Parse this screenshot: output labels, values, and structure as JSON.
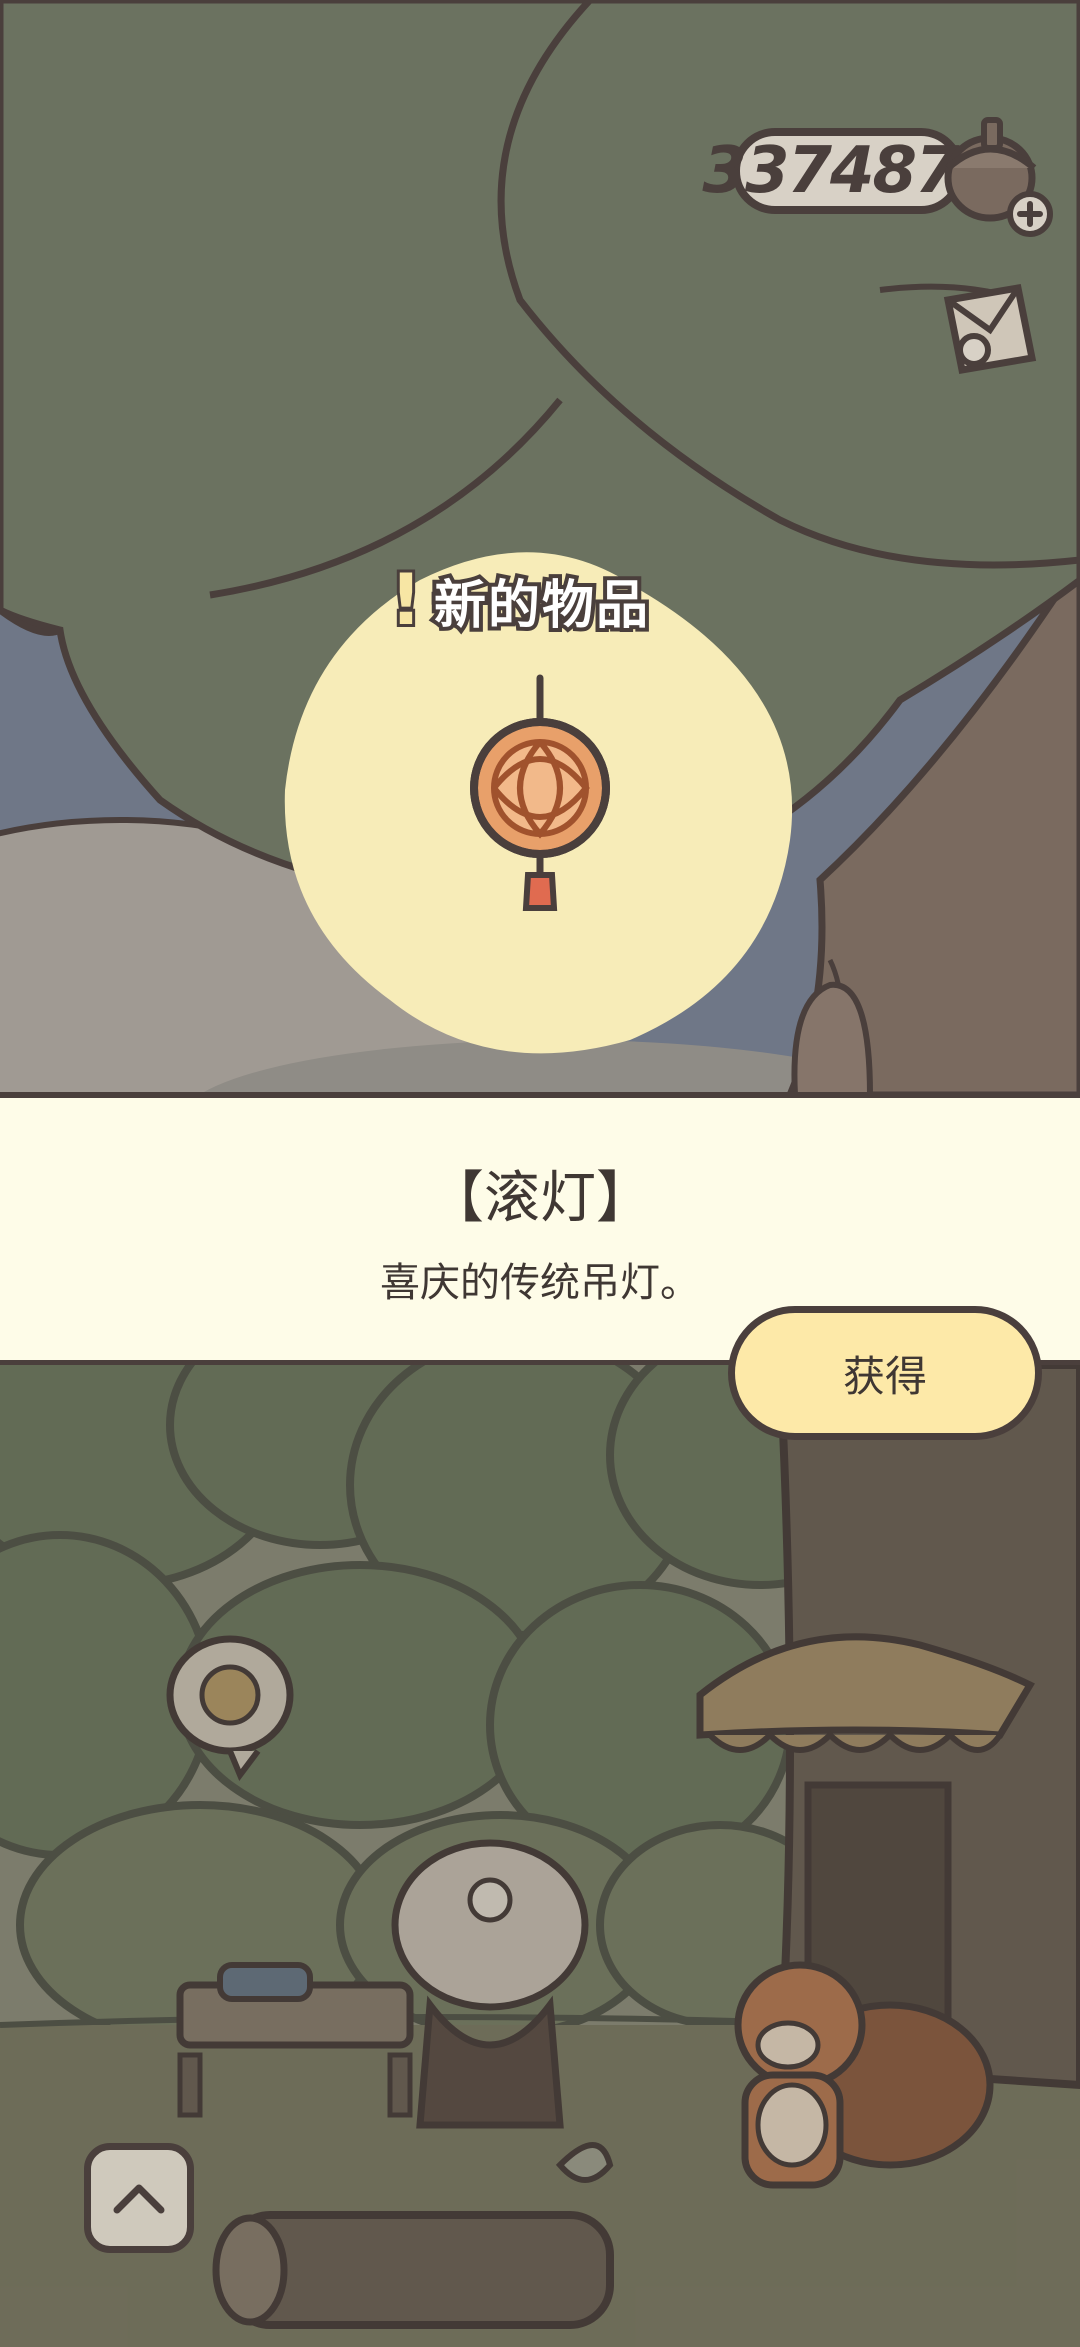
{
  "hud": {
    "acorn_count": "337487",
    "acorn_icon": "acorn-plus-icon",
    "mail_icon": "letter-icon"
  },
  "popup": {
    "badge": "!",
    "new_item_label": "新的物品",
    "item_icon": "lantern-icon",
    "item_name": "【滚灯】",
    "item_description": "喜庆的传统吊灯。",
    "obtain_label": "获得"
  },
  "controls": {
    "expand_icon": "chevron-up-icon"
  },
  "colors": {
    "foliage": "#6b7260",
    "outline": "#4a3f3c",
    "sky": "#6f7787",
    "highlight": "#f7ecb8",
    "panel": "#fefce8",
    "button": "#fde9a8"
  }
}
